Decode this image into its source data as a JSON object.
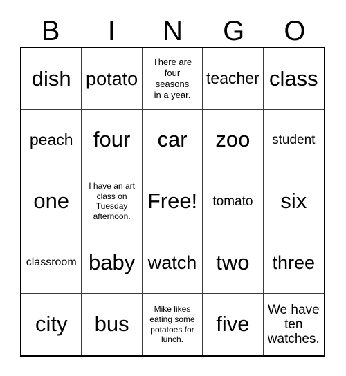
{
  "card": {
    "title": "BINGO",
    "header_letters": [
      "B",
      "I",
      "N",
      "G",
      "O"
    ],
    "columns": 5,
    "rows": 5,
    "free_space_label": "Free!",
    "border_color": "#000000",
    "grid_line_color": "#3b3b3b",
    "background_color": "#ffffff",
    "text_color": "#000000",
    "cells": [
      {
        "text": "dish",
        "size": "s-xl",
        "free": false
      },
      {
        "text": "potato",
        "size": "s-lg",
        "free": false
      },
      {
        "text": "There are\nfour\nseasons\nin a year.",
        "size": "s-xxs",
        "free": false
      },
      {
        "text": "teacher",
        "size": "s-md",
        "free": false
      },
      {
        "text": "class",
        "size": "s-xl",
        "free": false
      },
      {
        "text": "peach",
        "size": "s-md",
        "free": false
      },
      {
        "text": "four",
        "size": "s-xl",
        "free": false
      },
      {
        "text": "car",
        "size": "s-xl",
        "free": false
      },
      {
        "text": "zoo",
        "size": "s-xl",
        "free": false
      },
      {
        "text": "student",
        "size": "s-sm",
        "free": false
      },
      {
        "text": "one",
        "size": "s-xl",
        "free": false
      },
      {
        "text": "I have an art\nclass on\nTuesday\nafternoon.",
        "size": "s-tiny",
        "free": false
      },
      {
        "text": "Free!",
        "size": "s-xl",
        "free": true
      },
      {
        "text": "tomato",
        "size": "s-sm",
        "free": false
      },
      {
        "text": "six",
        "size": "s-xl",
        "free": false
      },
      {
        "text": "classroom",
        "size": "s-xs",
        "free": false
      },
      {
        "text": "baby",
        "size": "s-xl",
        "free": false
      },
      {
        "text": "watch",
        "size": "s-lg",
        "free": false
      },
      {
        "text": "two",
        "size": "s-xl",
        "free": false
      },
      {
        "text": "three",
        "size": "s-lg",
        "free": false
      },
      {
        "text": "city",
        "size": "s-xl",
        "free": false
      },
      {
        "text": "bus",
        "size": "s-xl",
        "free": false
      },
      {
        "text": "Mike likes\neating some\npotatoes for\nlunch.",
        "size": "s-tiny",
        "free": false
      },
      {
        "text": "five",
        "size": "s-xl",
        "free": false
      },
      {
        "text": "We have\nten\nwatches.",
        "size": "s-sm",
        "free": false
      }
    ]
  }
}
